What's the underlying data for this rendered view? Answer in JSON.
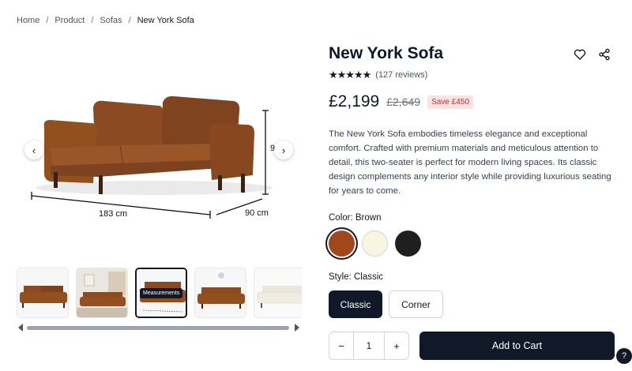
{
  "breadcrumb": {
    "items": [
      "Home",
      "Product",
      "Sofas",
      "New York Sofa"
    ],
    "separator": "/"
  },
  "gallery": {
    "dimension_width": "183 cm",
    "dimension_depth": "90 cm",
    "dimension_height_partial": "9",
    "prev_icon": "chevron-left-icon",
    "next_icon": "chevron-right-icon",
    "thumbnails_tooltip": "Measurements",
    "thumbnail_count": 5,
    "active_thumbnail": 3
  },
  "product": {
    "title": "New York Sofa",
    "rating_stars": 5,
    "reviews": "(127 reviews)",
    "price": "£2,199",
    "old_price": "£2,649",
    "save_badge": "Save £450",
    "description": "The New York Sofa embodies timeless elegance and exceptional comfort. Crafted with premium materials and meticulous attention to detail, this two-seater is perfect for modern living spaces. Its classic design complements any interior style while providing luxurious seating for years to come."
  },
  "options": {
    "color_label": "Color: Brown",
    "colors": [
      {
        "name": "Brown",
        "hex": "#a1481a",
        "selected": true
      },
      {
        "name": "Cream",
        "hex": "#f8f6e1",
        "selected": false
      },
      {
        "name": "Black",
        "hex": "#1f1f1f",
        "selected": false
      }
    ],
    "style_label": "Style: Classic",
    "styles": [
      "Classic",
      "Corner"
    ],
    "selected_style": "Classic"
  },
  "cart": {
    "minus": "−",
    "plus": "+",
    "quantity": "1",
    "add_to_cart": "Add to Cart"
  },
  "help": {
    "label": "?"
  },
  "icons": {
    "wishlist": "heart-icon",
    "share": "share-icon"
  },
  "colors": {
    "primary": "#111827",
    "sofa": "#8a4a21",
    "sale": "#dc2626",
    "sale_bg": "#fee2e2"
  }
}
